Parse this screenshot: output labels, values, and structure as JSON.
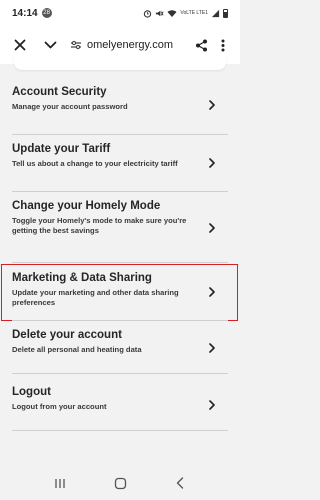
{
  "status_bar": {
    "time": "14:14",
    "notification_count": "28",
    "network_label": "VoLTE LTE1"
  },
  "browser": {
    "url": "omelyenergy.com"
  },
  "menu": {
    "items": [
      {
        "title": "Account Security",
        "description": "Manage your account password"
      },
      {
        "title": "Update your Tariff",
        "description": "Tell us about a change to your electricity tariff"
      },
      {
        "title": "Change your Homely Mode",
        "description": "Toggle your Homely's mode to make sure you're getting the best savings"
      },
      {
        "title": "Marketing & Data Sharing",
        "description": "Update your marketing and other data sharing preferences",
        "highlighted": true
      },
      {
        "title": "Delete your account",
        "description": "Delete all personal and heating data"
      },
      {
        "title": "Logout",
        "description": "Logout from your account"
      }
    ]
  },
  "colors": {
    "highlight_border": "#d42027",
    "divider": "#cfcfcf",
    "background": "#f2f2f2"
  },
  "icons": [
    "close-icon",
    "chevron-down-icon",
    "site-settings-icon",
    "share-icon",
    "more-vert-icon",
    "chevron-right-icon",
    "recents-icon",
    "home-icon",
    "back-icon"
  ]
}
